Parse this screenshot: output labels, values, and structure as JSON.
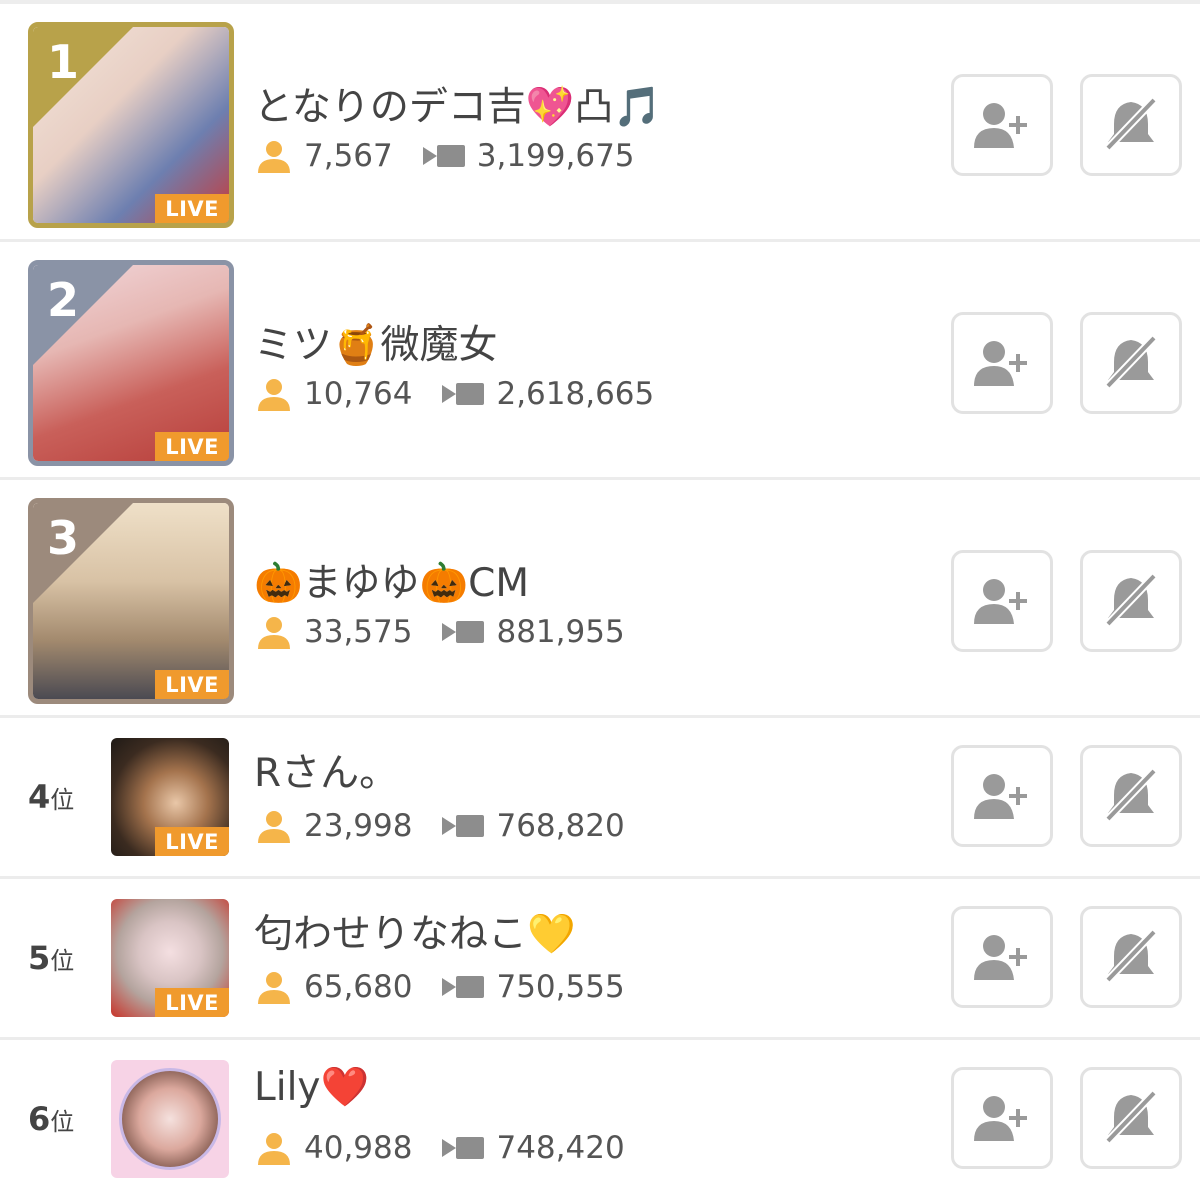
{
  "live_label": "LIVE",
  "rank_suffix": "位",
  "items": [
    {
      "rank": "1",
      "name": "となりのデコ吉💖凸🎵",
      "followers": "7,567",
      "views": "3,199,675",
      "live": true
    },
    {
      "rank": "2",
      "name": "ミツ🍯微魔女",
      "followers": "10,764",
      "views": "2,618,665",
      "live": true
    },
    {
      "rank": "3",
      "name": "🎃まゆゆ🎃CM",
      "followers": "33,575",
      "views": "881,955",
      "live": true
    },
    {
      "rank": "4",
      "name": "Rさん。",
      "followers": "23,998",
      "views": "768,820",
      "live": true
    },
    {
      "rank": "5",
      "name": "匂わせりなねこ💛",
      "followers": "65,680",
      "views": "750,555",
      "live": true
    },
    {
      "rank": "6",
      "name": "Lily❤️",
      "followers": "40,988",
      "views": "748,420",
      "live": false
    }
  ],
  "colors": {
    "gold": "#b8a24a",
    "silver": "#8a93a6",
    "bronze": "#9c8a7c",
    "live": "#f09a2d",
    "person_icon": "#f5b54a",
    "button_icon": "#9a9a9a"
  },
  "icons": {
    "followers": "person-icon",
    "views": "video-icon",
    "follow_button": "add-user-icon",
    "mute_button": "bell-off-icon"
  }
}
